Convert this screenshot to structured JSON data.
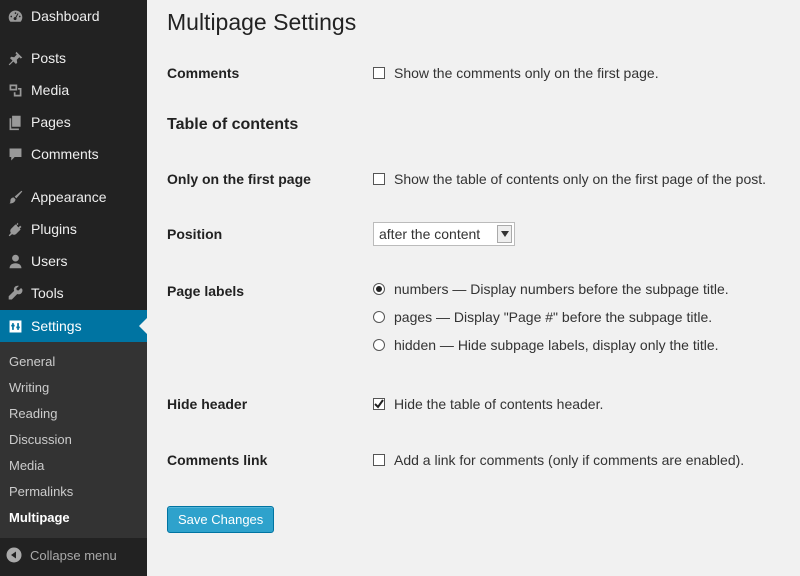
{
  "sidebar": {
    "items": [
      {
        "label": "Dashboard",
        "icon": "dashboard-icon"
      },
      {
        "label": "Posts",
        "icon": "pin-icon"
      },
      {
        "label": "Media",
        "icon": "media-icon"
      },
      {
        "label": "Pages",
        "icon": "pages-icon"
      },
      {
        "label": "Comments",
        "icon": "comment-icon"
      },
      {
        "label": "Appearance",
        "icon": "brush-icon"
      },
      {
        "label": "Plugins",
        "icon": "plugin-icon"
      },
      {
        "label": "Users",
        "icon": "user-icon"
      },
      {
        "label": "Tools",
        "icon": "wrench-icon"
      },
      {
        "label": "Settings",
        "icon": "settings-icon"
      }
    ],
    "submenu": [
      "General",
      "Writing",
      "Reading",
      "Discussion",
      "Media",
      "Permalinks",
      "Multipage"
    ],
    "collapse_label": "Collapse menu",
    "active_color": "#0074a2"
  },
  "main": {
    "title": "Multipage Settings",
    "comments": {
      "label": "Comments",
      "option": "Show the comments only on the first page.",
      "checked": false
    },
    "toc_title": "Table of contents",
    "first_page": {
      "label": "Only on the first page",
      "option": "Show the table of contents only on the first page of the post.",
      "checked": false
    },
    "position": {
      "label": "Position",
      "value": "after the content"
    },
    "page_labels": {
      "label": "Page labels",
      "options": [
        {
          "text": "numbers — Display numbers before the subpage title.",
          "selected": true
        },
        {
          "text": "pages — Display \"Page #\" before the subpage title.",
          "selected": false
        },
        {
          "text": "hidden — Hide subpage labels, display only the title.",
          "selected": false
        }
      ]
    },
    "hide_header": {
      "label": "Hide header",
      "option": "Hide the table of contents header.",
      "checked": true
    },
    "comments_link": {
      "label": "Comments link",
      "option": "Add a link for comments (only if comments are enabled).",
      "checked": false
    },
    "save_label": "Save Changes",
    "button_color": "#2ea2cc"
  }
}
